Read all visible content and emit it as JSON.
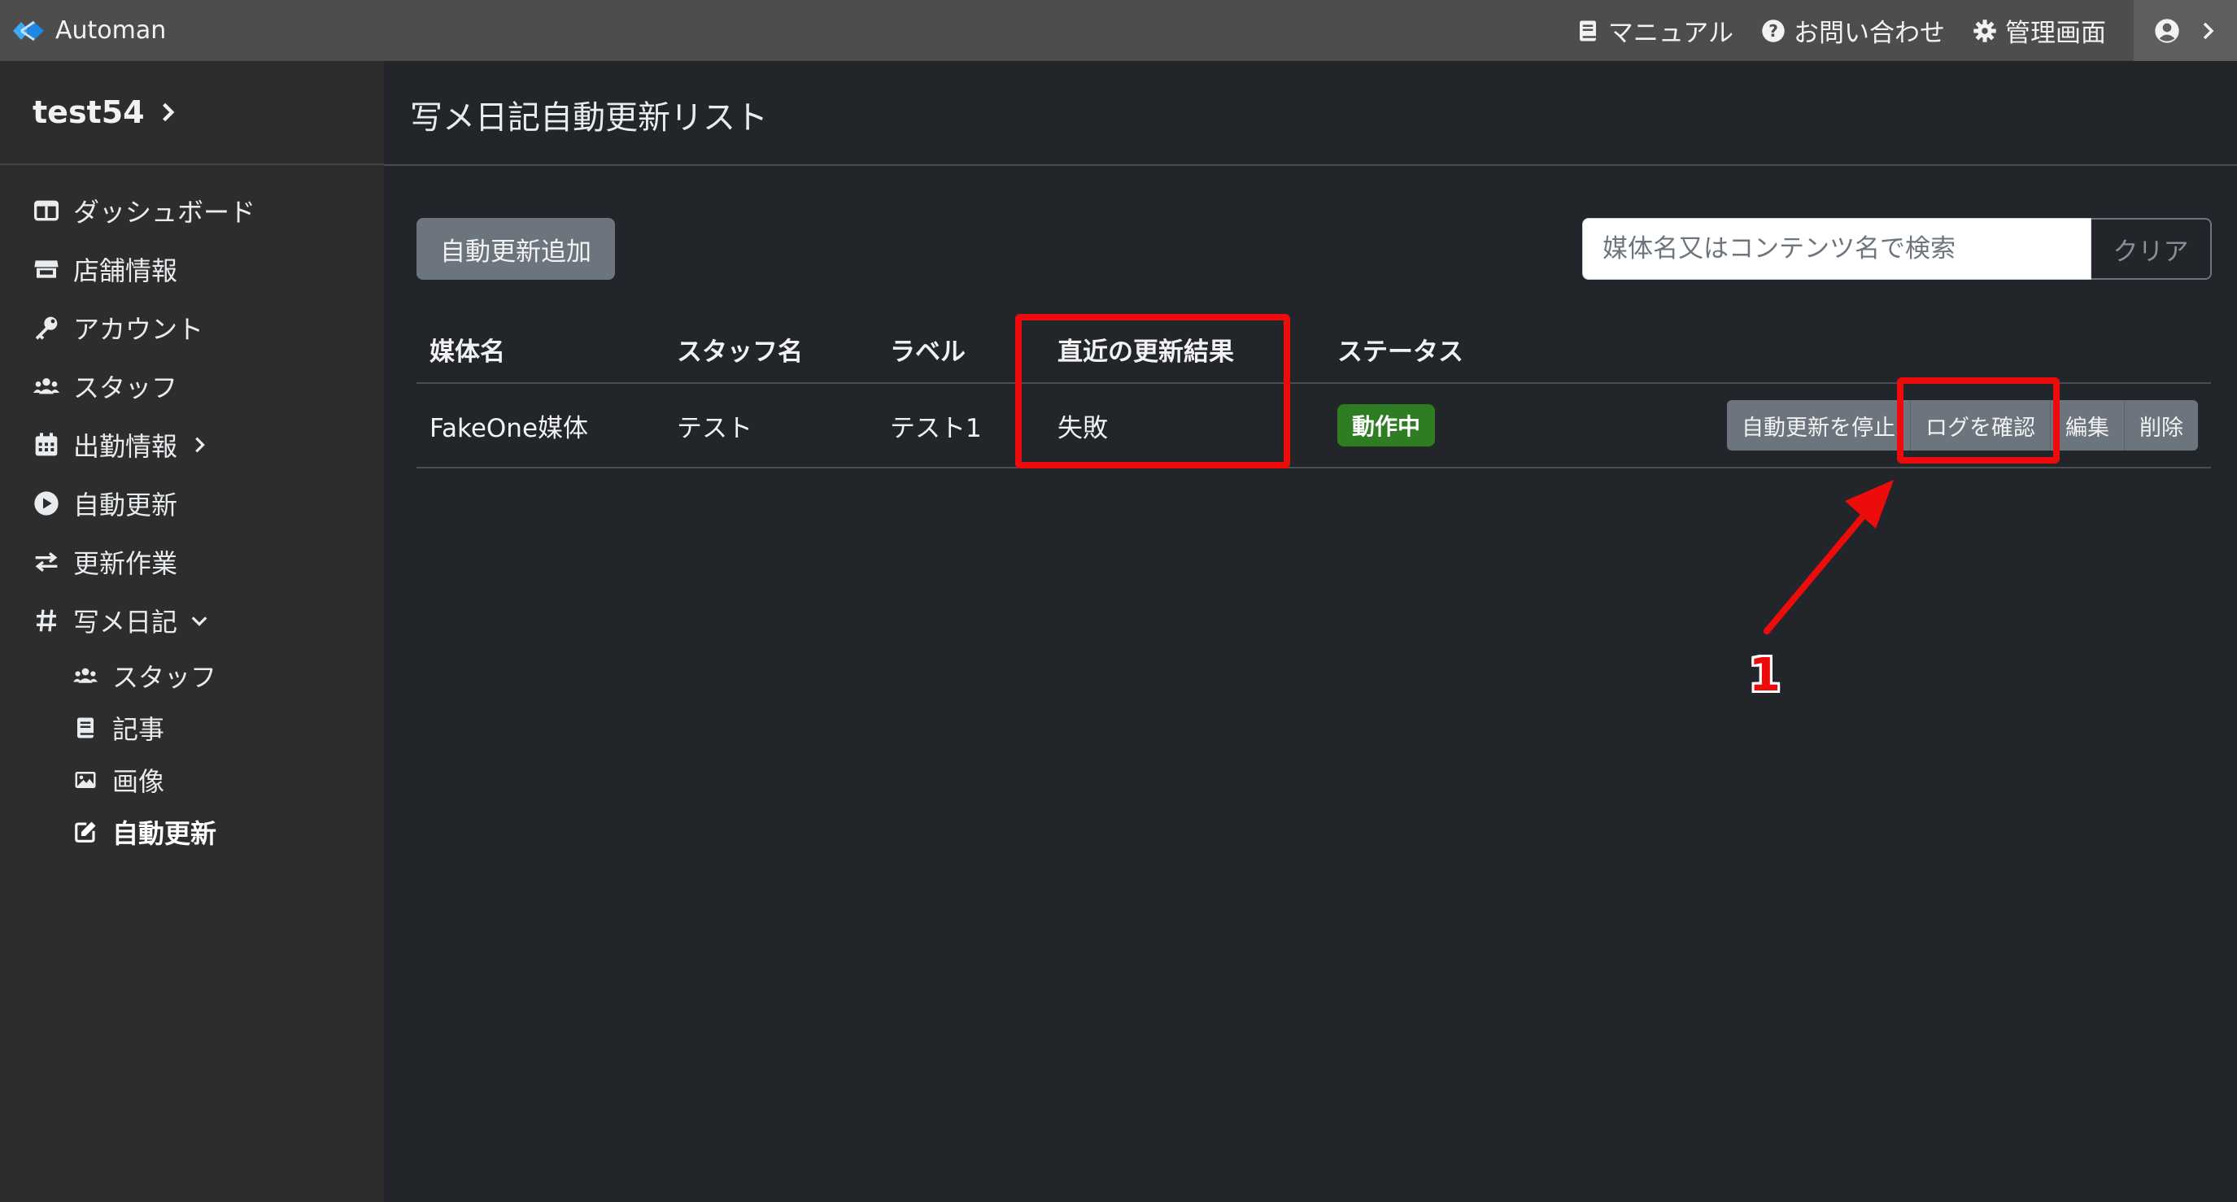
{
  "topbar": {
    "brand": "Automan",
    "nav": [
      {
        "label": "マニュアル",
        "icon": "book-icon"
      },
      {
        "label": "お問い合わせ",
        "icon": "question-circle-icon"
      },
      {
        "label": "管理画面",
        "icon": "gear-icon"
      }
    ],
    "user_icon": "user-circle-icon"
  },
  "sidebar": {
    "account": "test54",
    "items": [
      {
        "label": "ダッシュボード",
        "icon": "columns-icon"
      },
      {
        "label": "店舗情報",
        "icon": "store-icon"
      },
      {
        "label": "アカウント",
        "icon": "key-icon"
      },
      {
        "label": "スタッフ",
        "icon": "users-icon"
      },
      {
        "label": "出勤情報",
        "icon": "calendar-icon"
      },
      {
        "label": "自動更新",
        "icon": "play-circle-icon"
      },
      {
        "label": "更新作業",
        "icon": "exchange-icon"
      },
      {
        "label": "写メ日記",
        "icon": "hashtag-icon"
      }
    ],
    "sub_items": [
      {
        "label": "スタッフ",
        "icon": "users-icon"
      },
      {
        "label": "記事",
        "icon": "book-icon"
      },
      {
        "label": "画像",
        "icon": "image-icon"
      },
      {
        "label": "自動更新",
        "icon": "edit-icon",
        "active": true
      }
    ]
  },
  "main": {
    "title": "写メ日記自動更新リスト",
    "add_button": "自動更新追加",
    "search": {
      "placeholder": "媒体名又はコンテンツ名で検索",
      "value": ""
    },
    "clear_button": "クリア",
    "table": {
      "headers": [
        "媒体名",
        "スタッフ名",
        "ラベル",
        "直近の更新結果",
        "ステータス"
      ],
      "rows": [
        {
          "media": "FakeOne媒体",
          "staff": "テスト",
          "label": "テスト1",
          "result": "失敗",
          "status": "動作中",
          "actions": [
            "自動更新を停止",
            "ログを確認",
            "編集",
            "削除"
          ]
        }
      ]
    }
  },
  "annotation": {
    "number": "1",
    "color": "#ee0b0b"
  },
  "colors": {
    "status_badge": "#2e7d22",
    "secondary_button": "#6c757d",
    "topbar": "#4d4d4d",
    "sidebar": "#2d2d2d",
    "background": "#222529"
  }
}
